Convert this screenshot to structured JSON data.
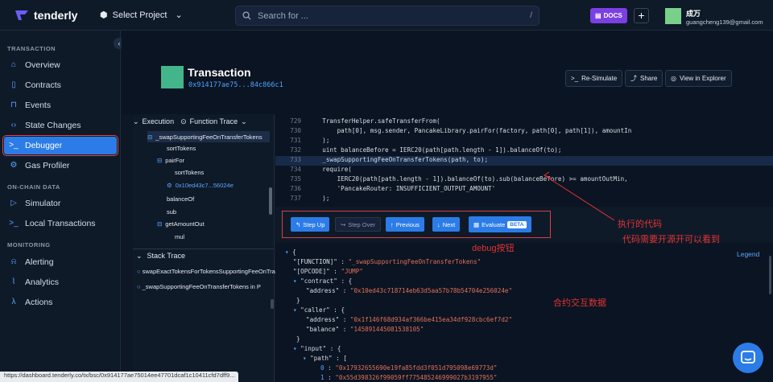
{
  "topbar": {
    "logo": "tenderly",
    "project": "Select Project",
    "search_placeholder": "Search for ...",
    "search_shortcut": "/",
    "docs": "DOCS",
    "plus": "+",
    "user_name": "成万",
    "user_email": "guangcheng139@gmail.com"
  },
  "sidebar": {
    "sections": [
      "TRANSACTION",
      "ON-CHAIN DATA",
      "MONITORING"
    ],
    "transaction_items": [
      "Overview",
      "Contracts",
      "Events",
      "State Changes",
      "Debugger",
      "Gas Profiler"
    ],
    "onchain_items": [
      "Simulator",
      "Local Transactions"
    ],
    "monitoring_items": [
      "Alerting",
      "Analytics",
      "Actions"
    ],
    "active": "Debugger"
  },
  "header": {
    "title": "Transaction",
    "hash": "0x914177ae75...84c866c1",
    "buttons": [
      "Re-Simulate",
      "Share",
      "View in Explorer"
    ]
  },
  "trace": {
    "tabs": [
      "Execution",
      "Function Trace"
    ],
    "rows": [
      "_swapSupportingFeeOnTransferTokens",
      "sortTokens",
      "pairFor",
      "sortTokens",
      "0x10ed43c7...56024e",
      "balanceOf",
      "sub",
      "getAmountOut",
      "mul"
    ]
  },
  "stack": {
    "title": "Stack Trace",
    "rows": [
      "swapExactTokensForTokensSupportingFeeOnTransferTokens",
      "_swapSupportingFeeOnTransferTokens in P"
    ]
  },
  "code": {
    "lines": [
      {
        "n": "729",
        "t": "    TransferHelper.safeTransferFrom("
      },
      {
        "n": "730",
        "t": "        path[0], msg.sender, PancakeLibrary.pairFor(factory, path[0], path[1]), amountIn"
      },
      {
        "n": "731",
        "t": "    );"
      },
      {
        "n": "732",
        "t": "    uint balanceBefore = IERC20(path[path.length - 1]).balanceOf(to);"
      },
      {
        "n": "733",
        "t": "    _swapSupportingFeeOnTransferTokens(path, to);"
      },
      {
        "n": "734",
        "t": "    require("
      },
      {
        "n": "735",
        "t": "        IERC20(path[path.length - 1]).balanceOf(to).sub(balanceBefore) >= amountOutMin,"
      },
      {
        "n": "736",
        "t": "        'PancakeRouter: INSUFFICIENT_OUTPUT_AMOUNT'"
      },
      {
        "n": "737",
        "t": "    );"
      }
    ],
    "highlight": "733"
  },
  "debug": {
    "step_up": "Step Up",
    "step_over": "Step Over",
    "previous": "Previous",
    "next": "Next",
    "evaluate": "Evaluate",
    "beta": "BETA"
  },
  "json_view": {
    "legend": "Legend",
    "function": "\"_swapSupportingFeeOnTransferTokens\"",
    "opcode": "\"JUMP\"",
    "contract_address": "\"0x10ed43c718714eb63d5aa57b78b54704e256024e\"",
    "caller_address": "\"0x1f146f68d934af366be415ea34df928cbc6ef7d2\"",
    "caller_balance": "\"145891445081538105\"",
    "path0": "\"0x17932655690e19fa85fdd3f051d795098e69773d\"",
    "path1": "\"0x55d398326f99059ff775485246999027b3197955\""
  },
  "annotations": {
    "code": "执行的代码",
    "code_note": "代码需要开源开可以看到",
    "debug": "debug按钮",
    "data": "合约交互数据"
  },
  "status": "https://dashboard.tenderly.co/tx/bsc/0x914177ae75014ee47701dcaf1c10411cfd7dff9..."
}
